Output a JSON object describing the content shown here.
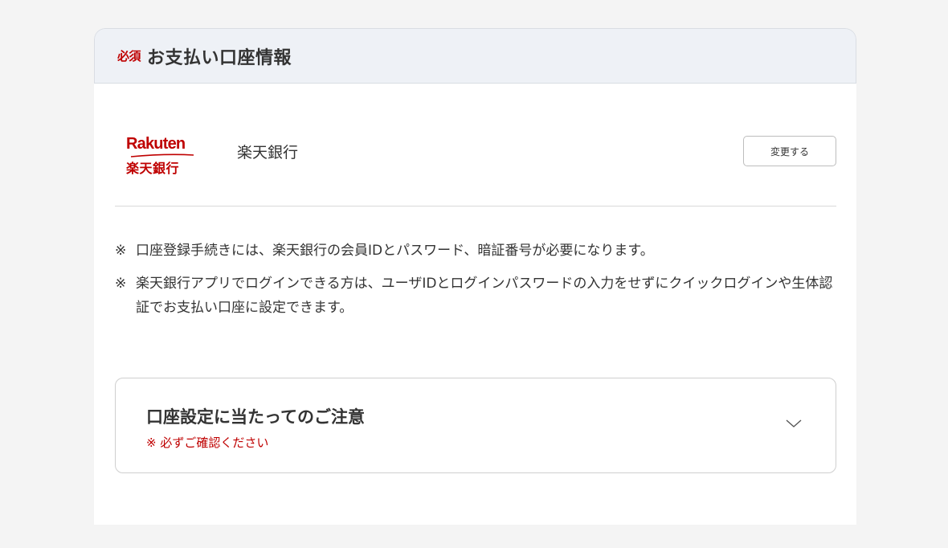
{
  "header": {
    "required_label": "必須",
    "title": "お支払い口座情報"
  },
  "bank": {
    "logo_en": "Rakuten",
    "logo_jp": "楽天銀行",
    "name": "楽天銀行",
    "change_label": "変更する"
  },
  "notes": [
    {
      "mark": "※",
      "text": "口座登録手続きには、楽天銀行の会員IDとパスワード、暗証番号が必要になります。"
    },
    {
      "mark": "※",
      "text": "楽天銀行アプリでログインできる方は、ユーザIDとログインパスワードの入力をせずにクイックログインや生体認証でお支払い口座に設定できます。"
    }
  ],
  "accordion": {
    "title": "口座設定に当たってのご注意",
    "subtitle": "※ 必ずご確認ください",
    "icon": "chevron-down-icon",
    "expanded": false
  },
  "colors": {
    "accent": "#bf0000",
    "header_bg": "#eef1f6",
    "page_bg": "#f4f4f4"
  }
}
